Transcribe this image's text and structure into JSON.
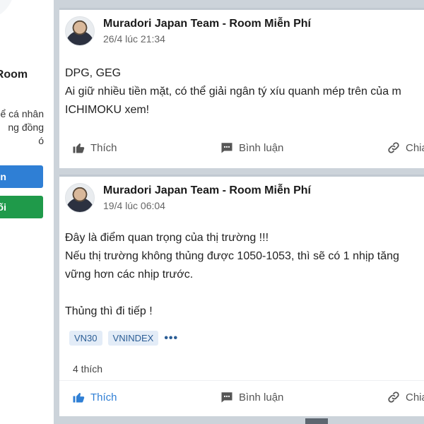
{
  "sidebar": {
    "name_fragment": "- Room",
    "description_lines": [
      "ể cá nhân",
      "ng   đồng",
      "ó"
    ],
    "button_blue_label": "in",
    "button_green_label": "ối"
  },
  "posts": [
    {
      "author": "Muradori Japan Team - Room Miễn Phí",
      "timestamp": "26/4 lúc 21:34",
      "lines": [
        "DPG, GEG",
        "Ai giữ nhiều tiền mặt, có thể giải ngân tý xíu quanh mép trên của m",
        "ICHIMOKU xem!"
      ],
      "actions": {
        "like": "Thích",
        "comment": "Bình luận",
        "share": "Chia"
      }
    },
    {
      "author": "Muradori Japan Team - Room Miễn Phí",
      "timestamp": "19/4 lúc 06:04",
      "lines": [
        "Đây là điểm quan trọng của thị trường !!!",
        "Nếu thị trường không thủng được 1050-1053, thì sẽ có 1 nhịp tăng",
        "vững hơn các nhịp trước.",
        "",
        "Thủng thì đi tiếp !"
      ],
      "tags": [
        "VN30",
        "VNINDEX"
      ],
      "more": "•••",
      "likes": "4 thích",
      "actions": {
        "like": "Thích",
        "comment": "Bình luận",
        "share": "Chia"
      }
    }
  ],
  "colors": {
    "accent_blue": "#2f7fd5",
    "green": "#1f9a4a",
    "feed_bg": "#ccd3da"
  }
}
